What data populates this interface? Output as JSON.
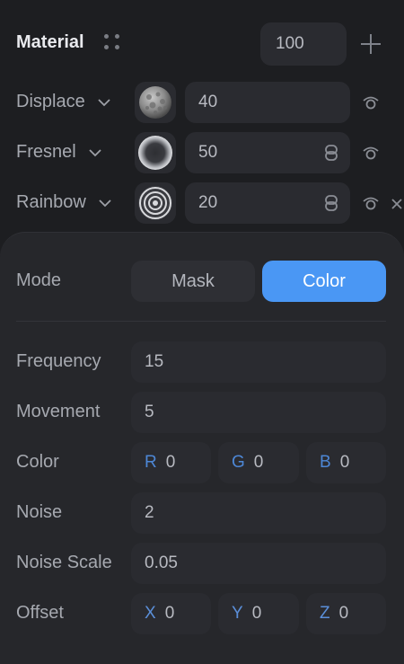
{
  "header": {
    "title": "Material",
    "value": "100"
  },
  "layers": [
    {
      "label": "Displace",
      "value": "40",
      "linked": false
    },
    {
      "label": "Fresnel",
      "value": "50",
      "linked": true
    },
    {
      "label": "Rainbow",
      "value": "20",
      "linked": true
    }
  ],
  "mode": {
    "label": "Mode",
    "options": [
      "Mask",
      "Color"
    ],
    "selected": "Color"
  },
  "props": {
    "frequency": {
      "label": "Frequency",
      "value": "15"
    },
    "movement": {
      "label": "Movement",
      "value": "5"
    },
    "color": {
      "label": "Color",
      "r_label": "R",
      "r": "0",
      "g_label": "G",
      "g": "0",
      "b_label": "B",
      "b": "0"
    },
    "noise": {
      "label": "Noise",
      "value": "2"
    },
    "noise_scale": {
      "label": "Noise Scale",
      "value": "0.05"
    },
    "offset": {
      "label": "Offset",
      "x_label": "X",
      "x": "0",
      "y_label": "Y",
      "y": "0",
      "z_label": "Z",
      "z": "0"
    }
  },
  "colors": {
    "accent": "#4a97f4",
    "panel": "#26272b",
    "field": "#2a2b30"
  }
}
